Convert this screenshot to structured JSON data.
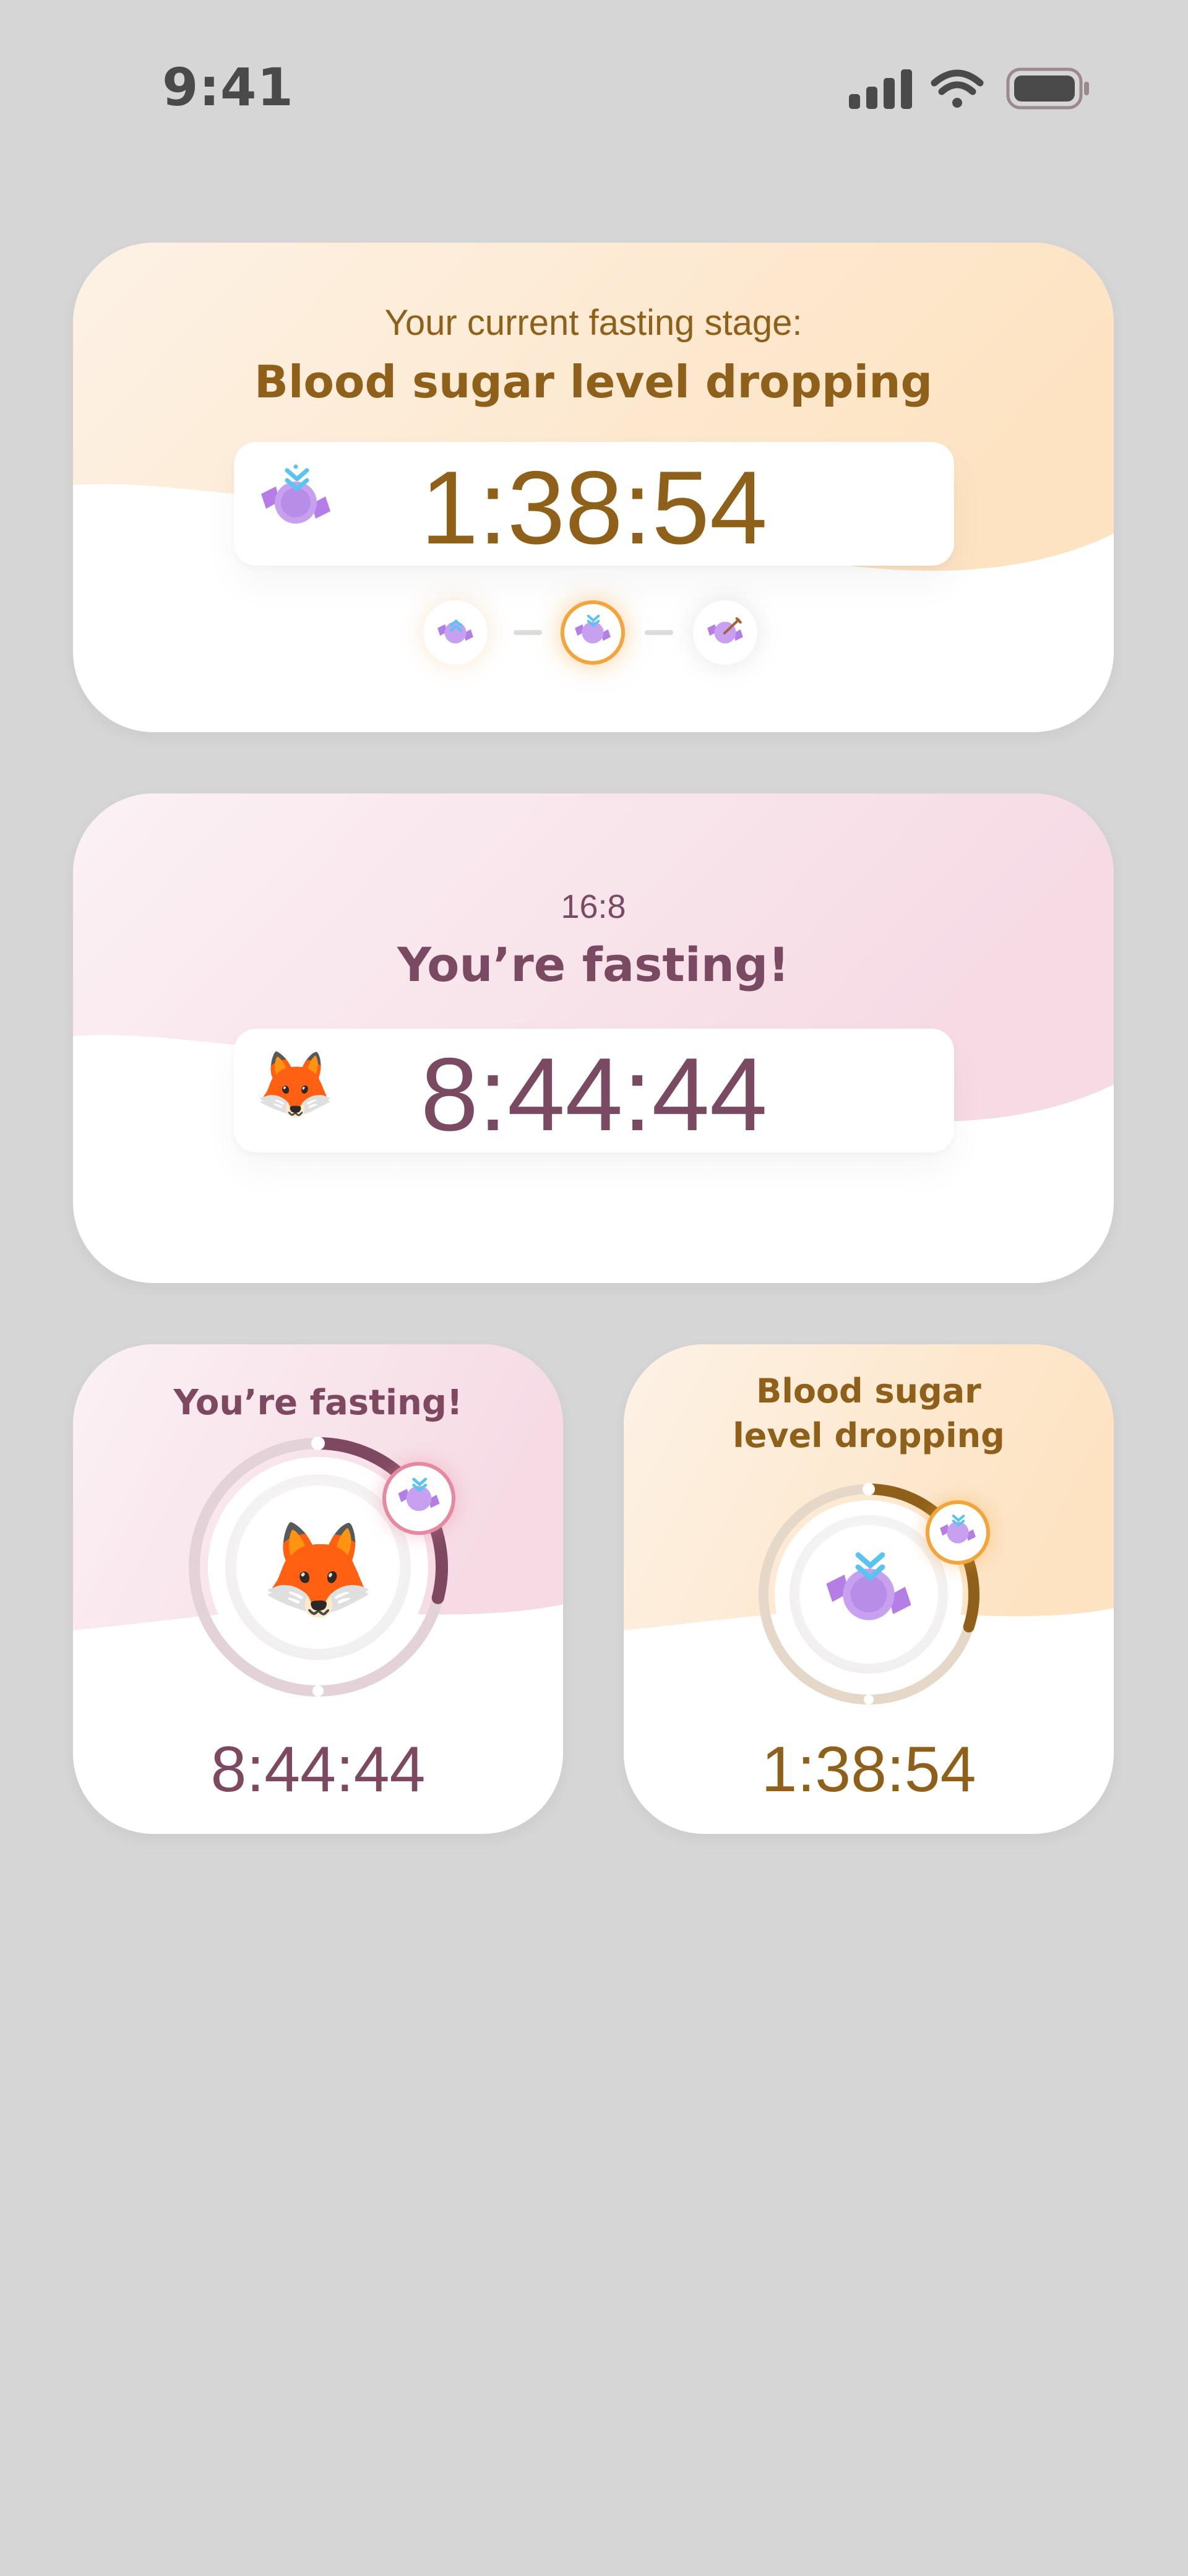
{
  "status_bar": {
    "time": "9:41",
    "icons": [
      "signal-icon",
      "wifi-icon",
      "battery-icon"
    ]
  },
  "widget_large_stage": {
    "caption": "Your current fasting stage:",
    "title": "Blood sugar level dropping",
    "timer": "1:38:54",
    "stage_icon": "candy-arrow-down-icon",
    "steps": [
      "candy-arrow-up-icon",
      "candy-arrow-down-icon",
      "candy-bitten-icon"
    ],
    "active_step": 1,
    "colors": {
      "accent": "#8f6019",
      "tint": "#fde3c0"
    }
  },
  "widget_large_fasting": {
    "plan": "16:8",
    "title": "You’re fasting!",
    "timer": "8:44:44",
    "avatar": "🦊",
    "colors": {
      "accent": "#7a4a62",
      "tint": "#f6dde6"
    }
  },
  "widget_small_fasting": {
    "title": "You’re fasting!",
    "timer": "8:44:44",
    "avatar": "🦊",
    "stage_icon": "candy-arrow-down-icon",
    "progress": 0.29,
    "colors": {
      "accent": "#7e4960",
      "tint": "#f6dde6"
    }
  },
  "widget_small_stage": {
    "title_line1": "Blood sugar",
    "title_line2": "level dropping",
    "timer": "1:38:54",
    "stage_icon": "candy-arrow-down-icon",
    "progress": 0.3,
    "colors": {
      "accent": "#8f6019",
      "tint": "#fde3c0"
    }
  }
}
